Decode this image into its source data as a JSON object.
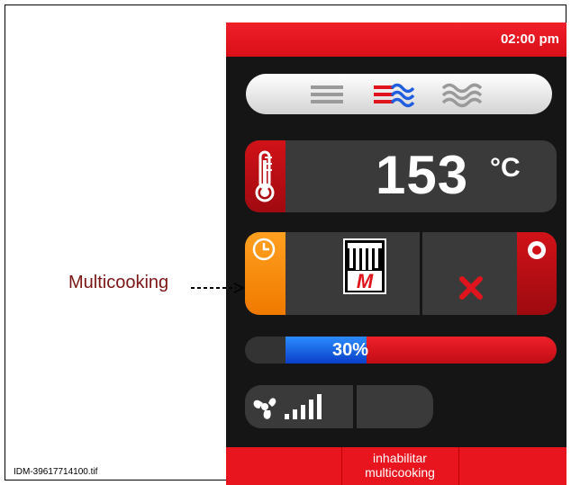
{
  "status_bar": {
    "time": "02:00 pm"
  },
  "cooking_modes": {
    "items": [
      "convection-mode-icon",
      "combi-mode-icon",
      "steam-mode-icon"
    ],
    "selected": "combi-mode-icon"
  },
  "temperature": {
    "value": "153",
    "unit": "°C"
  },
  "multicooking": {
    "program_icon": "multicooking-m-icon",
    "program_letter": "M",
    "cancel_icon": "close-icon"
  },
  "progress": {
    "value": 0.3,
    "label": "30%"
  },
  "fan": {
    "icon": "fan-icon",
    "level_icon": "signal-bars-icon"
  },
  "bottom_bar": {
    "center_label_line1": "inhabilitar",
    "center_label_line2": "multicooking"
  },
  "callout": {
    "label": "Multicooking"
  },
  "footer": {
    "file_id": "IDM-39617714100.tif"
  },
  "colors": {
    "red": "#e8141e",
    "orange": "#f88c10",
    "blue": "#1a5cf0",
    "dark": "#151515"
  }
}
